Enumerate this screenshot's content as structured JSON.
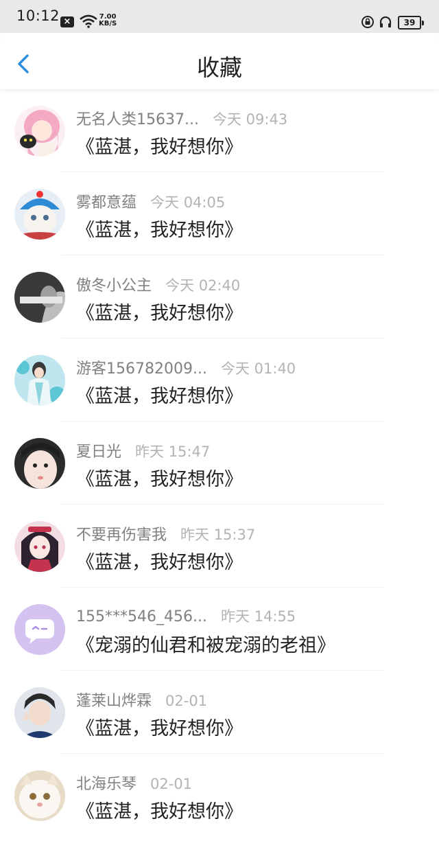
{
  "status_bar": {
    "time": "10:12",
    "net_speed_value": "7.00",
    "net_speed_unit": "KB/S",
    "battery": "39"
  },
  "header": {
    "title": "收藏"
  },
  "favorites": [
    {
      "name": "无名人类15637...",
      "time": "今天 09:43",
      "title": "《蓝湛，我好想你》",
      "avatar": "anime-girl-pink-hair"
    },
    {
      "name": "雾都意蕴",
      "time": "今天 04:05",
      "title": "《蓝湛，我好想你》",
      "avatar": "cat-blue-hat"
    },
    {
      "name": "傲冬小公主",
      "time": "今天 02:40",
      "title": "《蓝湛，我好想你》",
      "avatar": "grayscale-photo"
    },
    {
      "name": "游客156782009...",
      "time": "今天 01:40",
      "title": "《蓝湛，我好想你》",
      "avatar": "teal-ancient-costume"
    },
    {
      "name": "夏日光",
      "time": "昨天 15:47",
      "title": "《蓝湛，我好想你》",
      "avatar": "girl-portrait"
    },
    {
      "name": "不要再伤害我",
      "time": "昨天 15:37",
      "title": "《蓝湛，我好想你》",
      "avatar": "anime-girl-dark-hair"
    },
    {
      "name": "155***546_456...",
      "time": "昨天 14:55",
      "title": "《宠溺的仙君和被宠溺的老祖》",
      "avatar": "purple-chat-bubble"
    },
    {
      "name": "蓬莱山烨霖",
      "time": "02-01",
      "title": "《蓝湛，我好想你》",
      "avatar": "boy-peace-sign"
    },
    {
      "name": "北海乐琴",
      "time": "02-01",
      "title": "《蓝湛，我好想你》",
      "avatar": "white-cat"
    }
  ],
  "colors": {
    "accent_back": "#2a8fe0",
    "name_gray": "#808080",
    "time_gray": "#b3b3b3"
  }
}
